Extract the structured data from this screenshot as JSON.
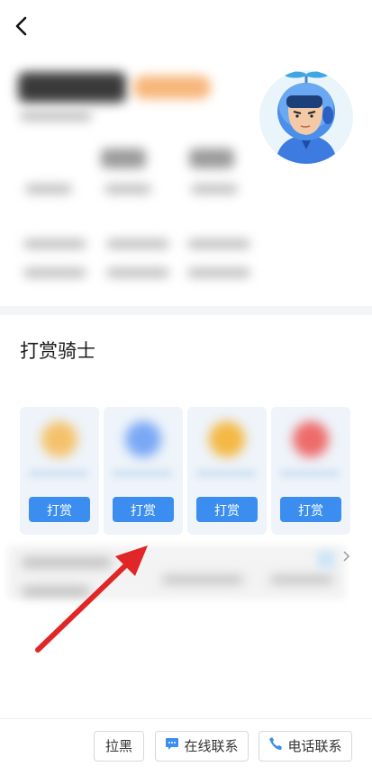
{
  "header": {
    "back_icon": "chevron-left-icon"
  },
  "tip_section": {
    "title": "打赏骑士",
    "options": [
      {
        "button_label": "打赏",
        "icon_color": "#f5c26b"
      },
      {
        "button_label": "打赏",
        "icon_color": "#7aa8f5"
      },
      {
        "button_label": "打赏",
        "icon_color": "#f4b844"
      },
      {
        "button_label": "打赏",
        "icon_color": "#ee6b6b"
      }
    ]
  },
  "bottom_bar": {
    "block_label": "拉黑",
    "online_contact_label": "在线联系",
    "online_contact_icon": "chat-bubble-icon",
    "phone_contact_label": "电话联系",
    "phone_contact_icon": "phone-icon"
  },
  "colors": {
    "accent": "#3b8ef0"
  }
}
